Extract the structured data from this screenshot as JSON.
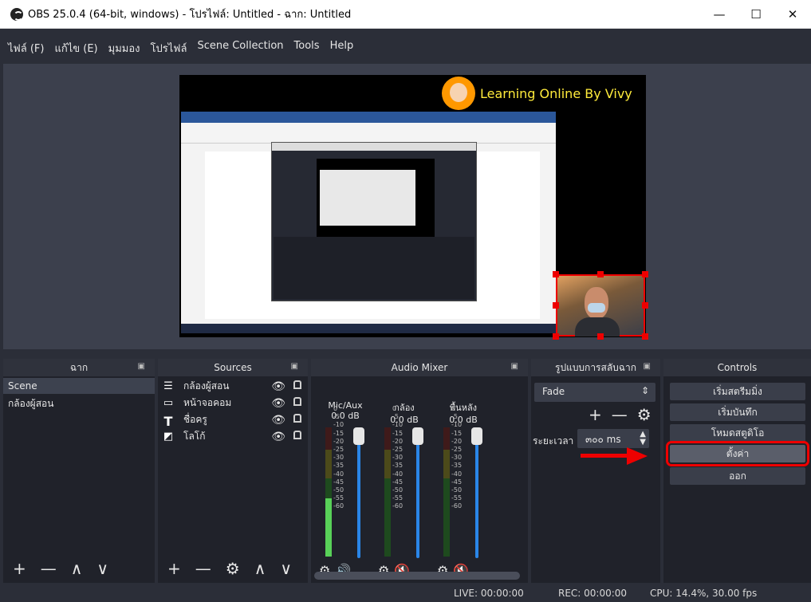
{
  "window": {
    "title": "OBS 25.0.4 (64-bit, windows) - โปรไฟล์: Untitled - ฉาก: Untitled",
    "minimize": "—",
    "maximize": "☐",
    "close": "✕"
  },
  "menu": [
    "ไฟล์ (F)",
    "แก้ไข (E)",
    "มุมมอง",
    "โปรไฟล์",
    "Scene Collection",
    "Tools",
    "Help"
  ],
  "preview": {
    "brand_text": "Learning Online By Vivy"
  },
  "scenes": {
    "title": "ฉาก",
    "items": [
      "Scene",
      "กล้องผู้สอน"
    ],
    "toolbar": [
      "+",
      "—",
      "∧",
      "∨"
    ]
  },
  "sources": {
    "title": "Sources",
    "items": [
      {
        "label": "กล้องผู้สอน",
        "icon": "camera-list-icon"
      },
      {
        "label": "หน้าจอคอม",
        "icon": "monitor-icon"
      },
      {
        "label": "ชื่อครู",
        "icon": "text-icon"
      },
      {
        "label": "โลโก้",
        "icon": "image-icon"
      }
    ],
    "toolbar": [
      "+",
      "—",
      "⚙",
      "∧",
      "∨"
    ]
  },
  "audio_mixer": {
    "title": "Audio Mixer",
    "channels": [
      {
        "name": "Mic/Aux",
        "db": "0.0 dB",
        "level": 0.45,
        "muted": false
      },
      {
        "name": "กล้อง",
        "db": "0.0 dB",
        "level": 0.0,
        "muted": true
      },
      {
        "name": "พื้นหลัง",
        "db": "0.0 dB",
        "level": 0.0,
        "muted": true
      }
    ],
    "scale": [
      "0",
      "-5",
      "-10",
      "-15",
      "-20",
      "-25",
      "-30",
      "-35",
      "-40",
      "-45",
      "-50",
      "-55",
      "-60"
    ]
  },
  "transitions": {
    "title": "รูปแบบการสลับฉาก",
    "selected": "Fade",
    "duration_label": "ระยะเวลา",
    "duration_value": "๓๐๐ ms"
  },
  "controls": {
    "title": "Controls",
    "buttons": [
      "เริ่มสตรีมมิ่ง",
      "เริ่มบันทึก",
      "โหมดสตูดิโอ",
      "ตั้งค่า",
      "ออก"
    ]
  },
  "status": {
    "live": "LIVE: 00:00:00",
    "rec": "REC: 00:00:00",
    "cpu": "CPU: 14.4%, 30.00 fps"
  },
  "colors": {
    "accent_blue": "#2a86e8",
    "highlight_red": "#e00000",
    "brand_yellow": "#ffeb3b"
  }
}
